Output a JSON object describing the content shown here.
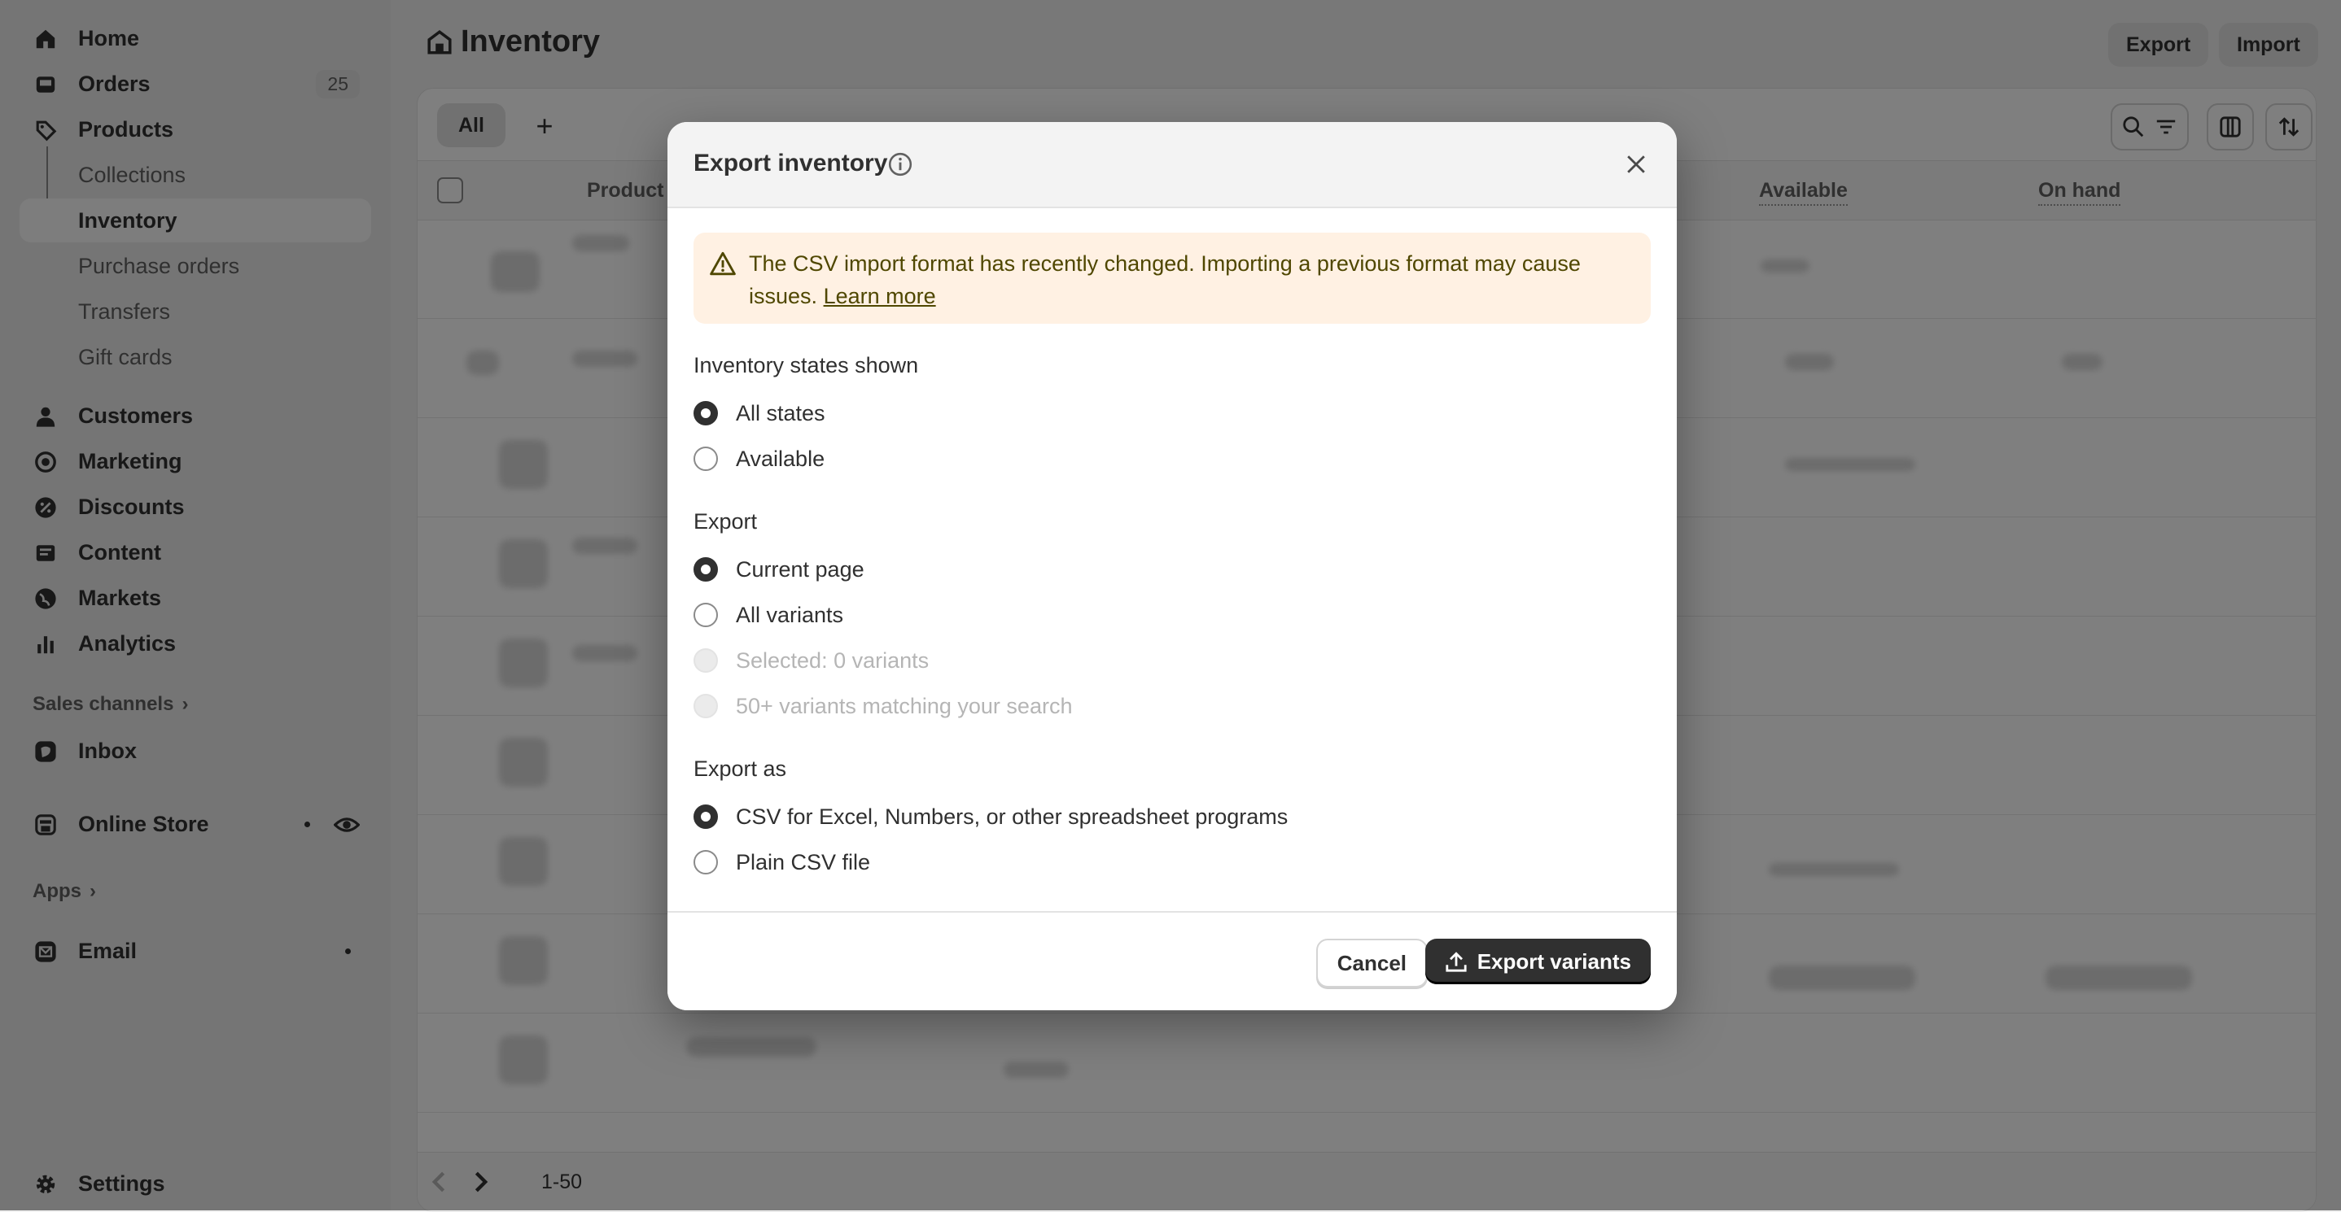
{
  "sidebar": {
    "items": [
      {
        "label": "Home",
        "icon": "home-icon"
      },
      {
        "label": "Orders",
        "icon": "inbox-icon",
        "badge": "25"
      },
      {
        "label": "Products",
        "icon": "tag-icon"
      },
      {
        "label": "Collections"
      },
      {
        "label": "Inventory",
        "active": true
      },
      {
        "label": "Purchase orders"
      },
      {
        "label": "Transfers"
      },
      {
        "label": "Gift cards"
      },
      {
        "label": "Customers",
        "icon": "person-icon"
      },
      {
        "label": "Marketing",
        "icon": "target-icon"
      },
      {
        "label": "Discounts",
        "icon": "discount-icon"
      },
      {
        "label": "Content",
        "icon": "content-icon"
      },
      {
        "label": "Markets",
        "icon": "globe-icon"
      },
      {
        "label": "Analytics",
        "icon": "bar-chart-icon"
      }
    ],
    "sales_channels_label": "Sales channels",
    "inbox_label": "Inbox",
    "online_store_label": "Online Store",
    "apps_label": "Apps",
    "email_label": "Email",
    "settings_label": "Settings"
  },
  "header": {
    "title": "Inventory",
    "export_label": "Export",
    "import_label": "Import"
  },
  "tabs": {
    "all_label": "All",
    "add_label": "+"
  },
  "table": {
    "columns": {
      "product": "Product",
      "available": "Available",
      "on_hand": "On hand"
    },
    "pagination": "1-50"
  },
  "modal": {
    "title": "Export inventory",
    "banner_text": "The CSV import format has recently changed. Importing a previous format may cause issues.",
    "banner_link": "Learn more",
    "states_label": "Inventory states shown",
    "states_options": [
      "All states",
      "Available"
    ],
    "export_label": "Export",
    "export_options": [
      "Current page",
      "All variants",
      "Selected: 0 variants",
      "50+ variants matching your search"
    ],
    "export_as_label": "Export as",
    "export_as_options": [
      "CSV for Excel, Numbers, or other spreadsheet programs",
      "Plain CSV file"
    ],
    "cancel_label": "Cancel",
    "primary_label": "Export variants"
  },
  "colors": {
    "primary": "#303030",
    "banner_bg": "#fff1e3",
    "overlay": "rgba(0,0,0,0.5)"
  }
}
